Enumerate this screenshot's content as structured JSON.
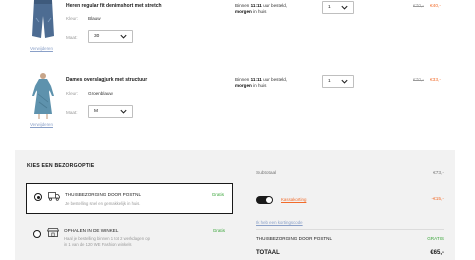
{
  "items": [
    {
      "title": "Heren regular fit denimshort met stretch",
      "color_label": "Kleur:",
      "color_value": "Blauw",
      "size_label": "Maat:",
      "size_value": "30",
      "delivery_prefix": "Binnen",
      "delivery_time": "11:11",
      "delivery_suffix": "uur besteld,",
      "delivery_day": "morgen",
      "delivery_end": "in huis",
      "quantity": "1",
      "price_old": "€70,-",
      "price_new": "€40,-",
      "remove_label": "Verwijderen"
    },
    {
      "title": "Dames overslagjurk met structuur",
      "color_label": "Kleur:",
      "color_value": "Groenblauw",
      "size_label": "Maat:",
      "size_value": "M",
      "delivery_prefix": "Binnen",
      "delivery_time": "11:11",
      "delivery_suffix": "uur besteld,",
      "delivery_day": "morgen",
      "delivery_end": "in huis",
      "quantity": "1",
      "price_old": "€70,-",
      "price_new": "€33,-",
      "remove_label": "Verwijderen"
    }
  ],
  "delivery_section": {
    "title": "KIES EEN BEZORGOPTIE",
    "options": [
      {
        "name": "THUISBEZORGING DOOR POSTNL",
        "description": "Je bestelling snel en gemakkelijk in huis.",
        "price": "Gratis",
        "selected": true,
        "icon": "truck-icon"
      },
      {
        "name": "OPHALEN IN DE WINKEL",
        "description_line1": "Haal je bestelling binnen 1 tot 2 werkdagen op",
        "description_line2": "in 1 van de 120 WE Fashion winkels",
        "price": "Gratis",
        "selected": false,
        "icon": "store-icon"
      }
    ]
  },
  "summary": {
    "subtotal_label": "Subtotaal",
    "subtotal_value": "€73,-",
    "discount_label": "Kassakorting",
    "discount_value": "-€15,-",
    "promo_link": "Ik heb een kortingscode",
    "shipping_label": "THUISBEZORGING DOOR POSTNL",
    "shipping_value": "GRATIS",
    "total_label": "TOTAAL",
    "total_value": "€65,-"
  },
  "colors": {
    "accent": "#f26b2a",
    "free": "#3aa63a",
    "link": "#8aa0c8"
  }
}
